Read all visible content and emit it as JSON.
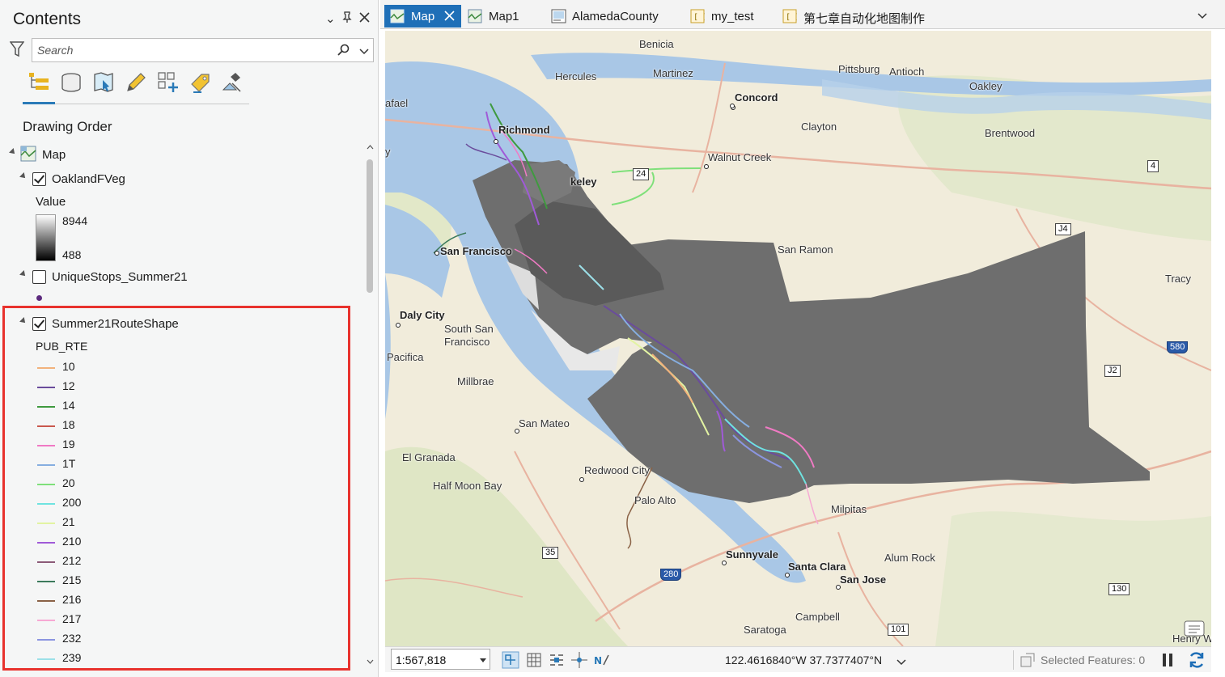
{
  "contents": {
    "title": "Contents",
    "search_placeholder": "Search",
    "section_title": "Drawing Order",
    "toolbar_icons": [
      "list-by-drawing-order-icon",
      "list-by-source-icon",
      "list-by-selection-icon",
      "list-by-editing-icon",
      "list-by-snapping-icon",
      "list-by-labeling-icon",
      "list-by-perspective-imagery-icon"
    ],
    "map_node": "Map",
    "layers": {
      "veg": {
        "name": "OaklandFVeg",
        "checked": true,
        "field": "Value",
        "high": "8944",
        "low": "488"
      },
      "stops": {
        "name": "UniqueStops_Summer21",
        "checked": false
      },
      "routes": {
        "name": "Summer21RouteShape",
        "checked": true,
        "field": "PUB_RTE"
      }
    },
    "legend": [
      {
        "label": "10",
        "color": "#f2b27c"
      },
      {
        "label": "12",
        "color": "#6a4c9c"
      },
      {
        "label": "14",
        "color": "#3f9a3f"
      },
      {
        "label": "18",
        "color": "#c9584e"
      },
      {
        "label": "19",
        "color": "#f07ac4"
      },
      {
        "label": "1T",
        "color": "#86aee0"
      },
      {
        "label": "20",
        "color": "#7fe07a"
      },
      {
        "label": "200",
        "color": "#6fe3e0"
      },
      {
        "label": "21",
        "color": "#e2f3a2"
      },
      {
        "label": "210",
        "color": "#a05ad8"
      },
      {
        "label": "212",
        "color": "#8c5a78"
      },
      {
        "label": "215",
        "color": "#3c7a5c"
      },
      {
        "label": "216",
        "color": "#8a6246"
      },
      {
        "label": "217",
        "color": "#f7a9d4"
      },
      {
        "label": "232",
        "color": "#8b95e0"
      },
      {
        "label": "239",
        "color": "#9ce0e8"
      }
    ]
  },
  "tabs": [
    {
      "label": "Map",
      "active": true
    },
    {
      "label": "Map1",
      "active": false
    },
    {
      "label": "AlamedaCounty",
      "active": false
    },
    {
      "label": "my_test",
      "active": false
    },
    {
      "label": "第七章自动化地图制作",
      "active": false
    }
  ],
  "map": {
    "places": [
      "Benicia",
      "Hercules",
      "Martinez",
      "Pittsburg",
      "Antioch",
      "Oakley",
      "afael",
      "Concord",
      "Richmond",
      "Clayton",
      "Brentwood",
      "Walnut Creek",
      "keley",
      "San Francisco",
      "San Ramon",
      "Tracy",
      "Daly City",
      "South San",
      "Francisco",
      "Pacifica",
      "Millbrae",
      "San Mateo",
      "El Granada",
      "Redwood City",
      "Half Moon Bay",
      "Palo Alto",
      "Milpitas",
      "Sunnyvale",
      "Santa Clara",
      "Alum Rock",
      "San Jose",
      "Campbell",
      "Saratoga",
      "Henry W",
      "y"
    ],
    "shields": [
      "24",
      "4",
      "J4",
      "580",
      "J2",
      "35",
      "280",
      "130",
      "101"
    ]
  },
  "status": {
    "scale": "1:567,818",
    "coordinates": "122.4616840°W 37.7377407°N",
    "selected_features": "Selected Features: 0"
  }
}
